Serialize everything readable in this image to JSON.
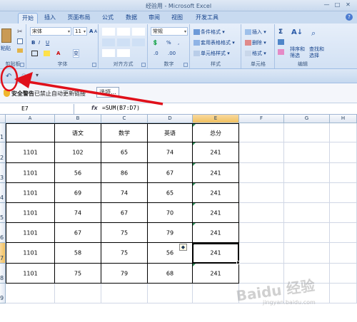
{
  "title": "经验用 - Microsoft Excel",
  "tabs": [
    "开始",
    "插入",
    "页面布局",
    "公式",
    "数据",
    "审阅",
    "视图",
    "开发工具"
  ],
  "ribbon": {
    "clipboard": {
      "label": "剪贴板",
      "paste": "粘贴"
    },
    "font": {
      "label": "字体",
      "font_name": "宋体",
      "font_size": "11",
      "bold": "B",
      "italic": "I",
      "underline": "U",
      "grow": "A",
      "shrink": "A",
      "phonetic": "变"
    },
    "alignment": {
      "label": "对齐方式"
    },
    "number": {
      "label": "数字",
      "format": "常规",
      "percent": "%",
      "comma": ",",
      "inc": ".0",
      "dec": ".00"
    },
    "styles": {
      "label": "样式",
      "conditional": "条件格式",
      "table": "套用表格格式",
      "cell": "单元格样式"
    },
    "cells": {
      "label": "单元格",
      "insert": "插入",
      "delete": "删除",
      "format": "格式"
    },
    "editing": {
      "label": "编辑",
      "sigma": "Σ",
      "sort": "排序和",
      "sort2": "筛选",
      "find": "查找和",
      "find2": "选择"
    }
  },
  "security": {
    "warning": "安全警告",
    "message": "已禁止自动更新链接",
    "options": "选项..."
  },
  "formula_bar": {
    "name_box": "E7",
    "fx": "fx",
    "formula": "=SUM(B7:D7)"
  },
  "columns": [
    "A",
    "B",
    "C",
    "D",
    "E",
    "F",
    "G",
    "H"
  ],
  "rows": [
    "1",
    "2",
    "3",
    "4",
    "5",
    "6",
    "7",
    "8",
    "9"
  ],
  "table": {
    "headers": [
      "",
      "语文",
      "数学",
      "英语",
      "总分"
    ],
    "data": [
      [
        "1101",
        "102",
        "65",
        "74",
        "241"
      ],
      [
        "1101",
        "56",
        "86",
        "67",
        "241"
      ],
      [
        "1101",
        "69",
        "74",
        "65",
        "241"
      ],
      [
        "1101",
        "74",
        "67",
        "70",
        "241"
      ],
      [
        "1101",
        "67",
        "75",
        "79",
        "241"
      ],
      [
        "1101",
        "58",
        "75",
        "56",
        "241"
      ],
      [
        "1101",
        "75",
        "79",
        "68",
        "241"
      ]
    ]
  },
  "colors": {
    "annotation": "#e0101a",
    "selection": "#000000",
    "header_selected": "#f5c46a"
  },
  "watermark": {
    "brand": "Baidu 经验",
    "url": "jingyan.baidu.com"
  }
}
